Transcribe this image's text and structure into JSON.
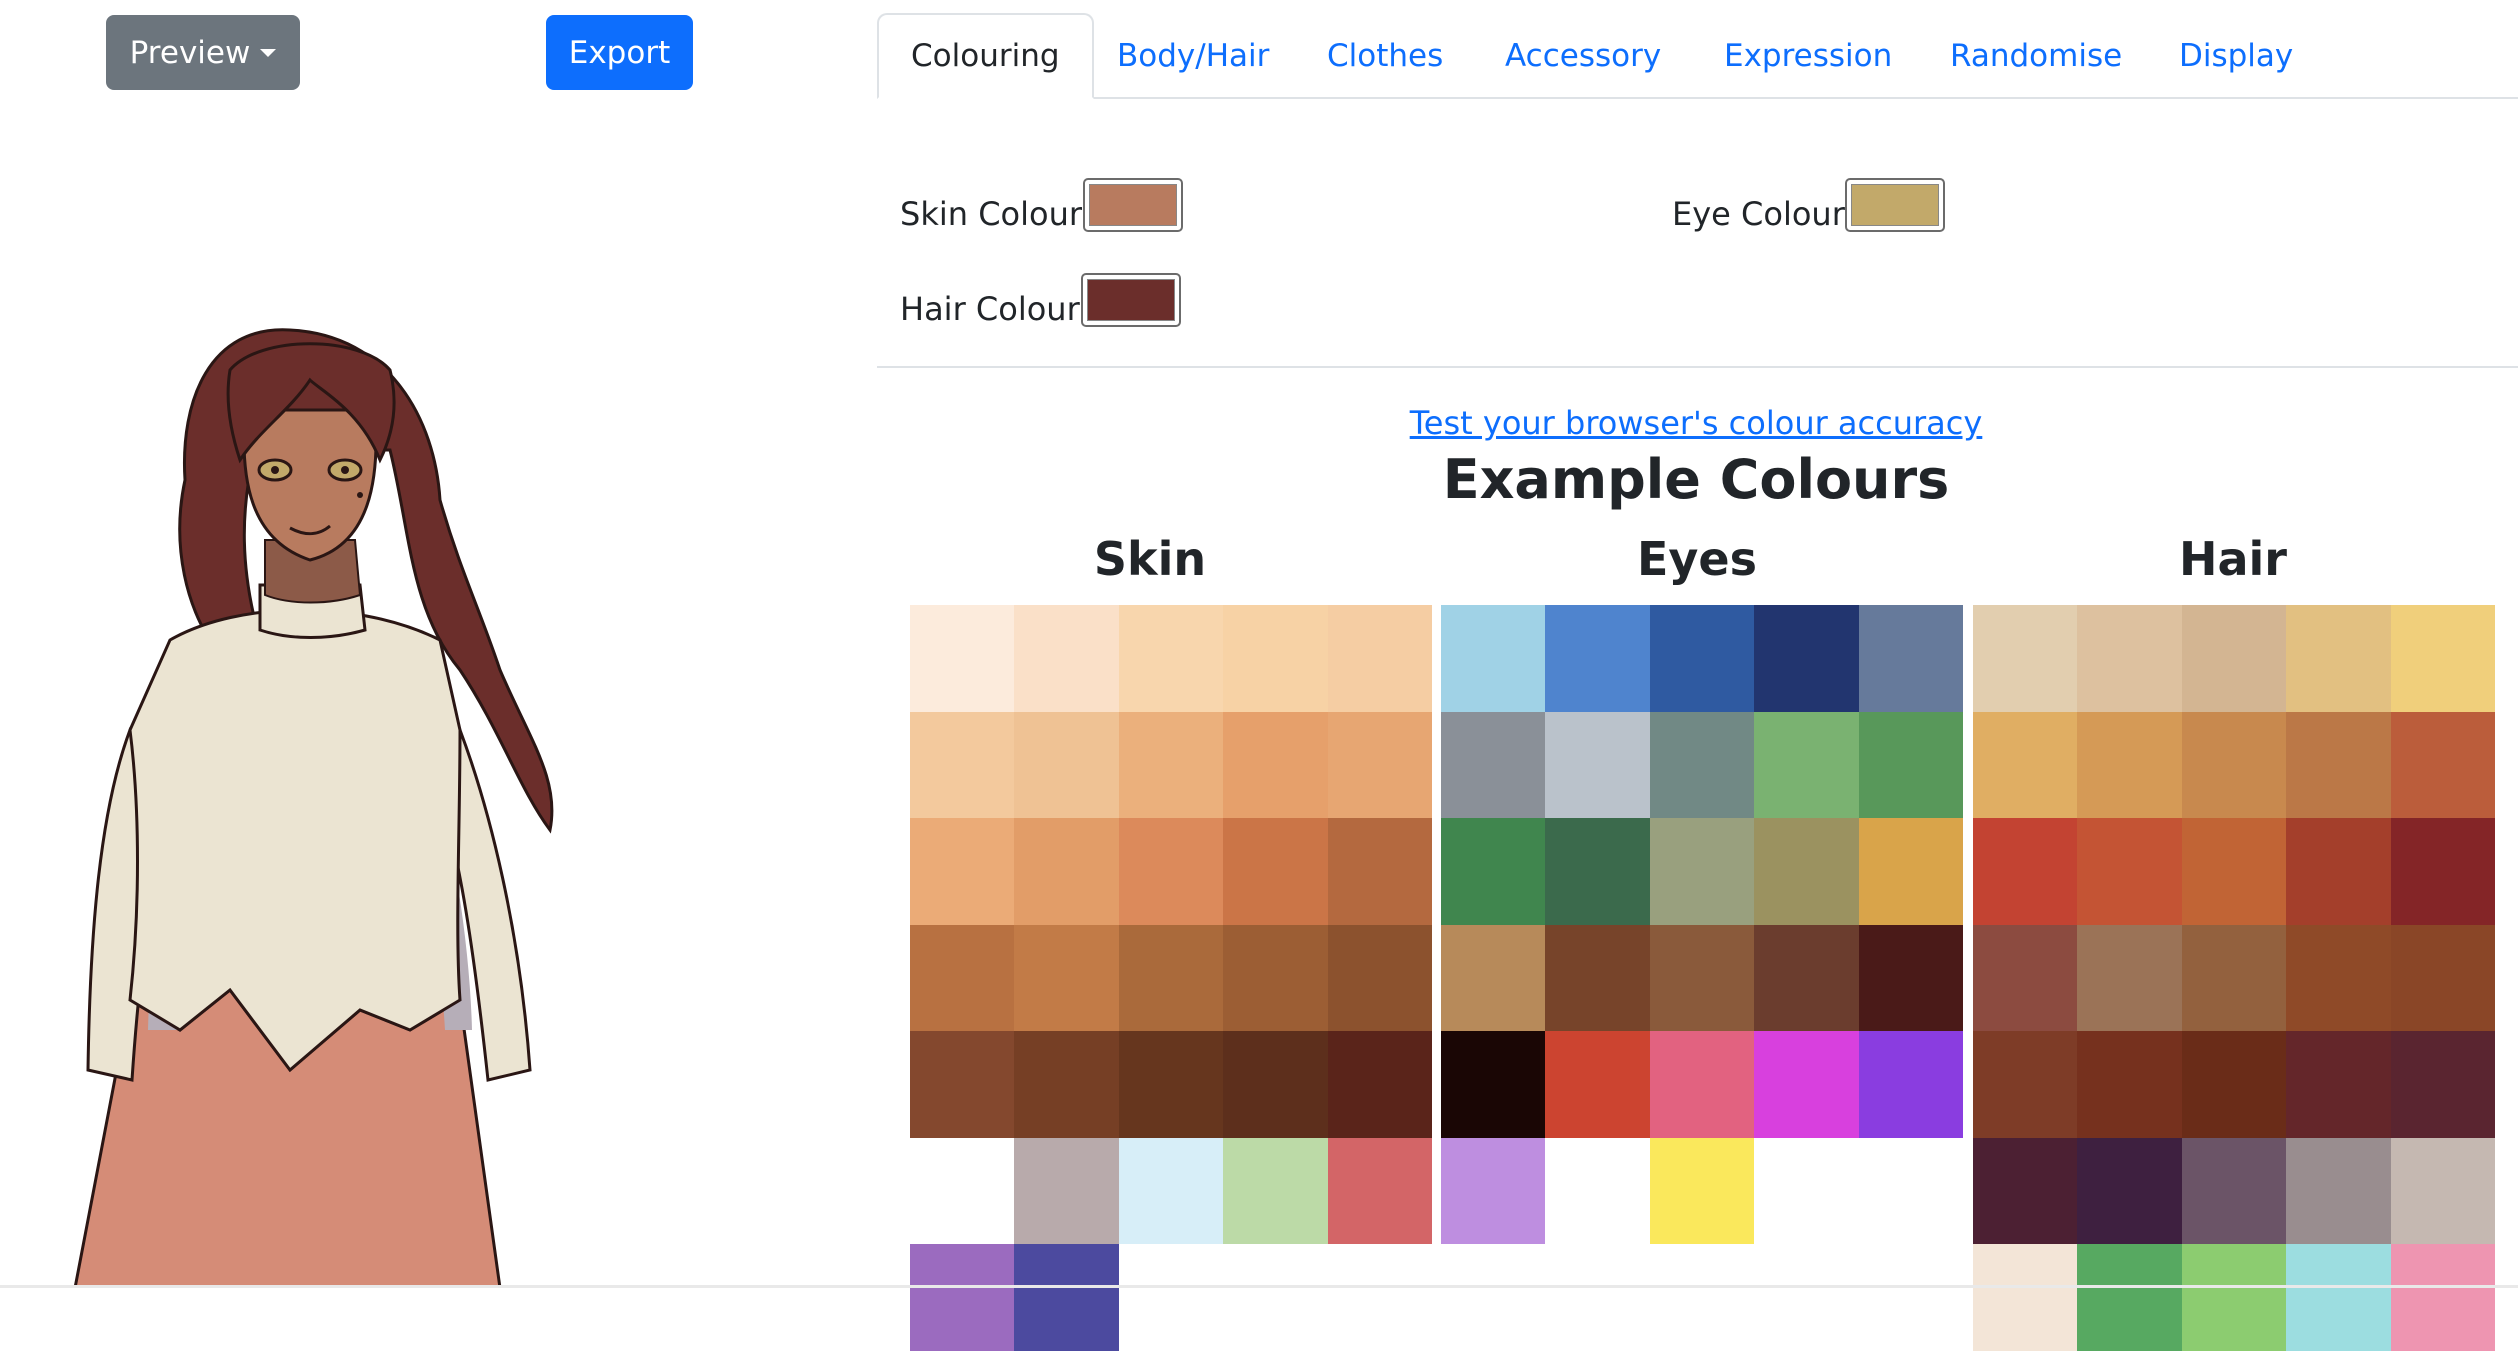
{
  "toolbar": {
    "preview_label": "Preview",
    "export_label": "Export"
  },
  "tabs": [
    {
      "label": "Colouring",
      "active": true
    },
    {
      "label": "Body/Hair"
    },
    {
      "label": "Clothes"
    },
    {
      "label": "Accessory"
    },
    {
      "label": "Expression"
    },
    {
      "label": "Randomise"
    },
    {
      "label": "Display"
    }
  ],
  "colouring": {
    "skin_label": "Skin Colour:",
    "skin_value": "#b87b5f",
    "eye_label": "Eye Colour:",
    "eye_value": "#c2a96a",
    "hair_label": "Hair Colour:",
    "hair_value": "#6b2e2b"
  },
  "accuracy_link": "Test your browser's colour accuracy",
  "examples": {
    "title": "Example Colours",
    "skin": {
      "title": "Skin",
      "rows": [
        [
          "#fcebdc",
          "#fae0c8",
          "#f8d6ad",
          "#f7d2a5",
          "#f5cda3"
        ],
        [
          "#f3c99d",
          "#efc294",
          "#ebb07c",
          "#e6a06b",
          "#e7a672"
        ],
        [
          "#ebab77",
          "#e29d68",
          "#dc8a5b",
          "#cb7547",
          "#b4693f"
        ],
        [
          "#b87141",
          "#c27b47",
          "#aa6a3b",
          "#9c5e34",
          "#8c522e"
        ],
        [
          "#84482e",
          "#763f25",
          "#66361e",
          "#5d2f1c",
          "#5a241a"
        ],
        [
          null,
          "#b8aaab",
          "#d7eef8",
          "#bcdaa7",
          "#d36567"
        ],
        [
          "#9b6bbf",
          "#4c4a9f",
          null,
          null,
          null
        ]
      ]
    },
    "eyes": {
      "title": "Eyes",
      "rows": [
        [
          "#a0d2e6",
          "#4f84ce",
          "#2f5aa1",
          "#22356f",
          "#667a9b"
        ],
        [
          "#8a9098",
          "#bac2cb",
          "#718985",
          "#7ab271",
          "#58985a"
        ],
        [
          "#40864e",
          "#3b6a4c",
          "#99a07e",
          "#9b9260",
          "#d9a44a"
        ],
        [
          "#b78a5a",
          "#77442a",
          "#8a5a3b",
          "#6b3d2e",
          "#4a1a18"
        ],
        [
          "#1a0605",
          "#cc4430",
          "#e26280",
          "#d840de",
          "#8a3de0"
        ],
        [
          "#be8ee0",
          null,
          "#fae85c",
          null,
          null
        ]
      ]
    },
    "hair": {
      "title": "Hair",
      "rows": [
        [
          "#e2ceaf",
          "#ddc19f",
          "#d3b592",
          "#e2c081",
          "#f0cf7b"
        ],
        [
          "#e0ae63",
          "#d59a56",
          "#c8894e",
          "#bb7847",
          "#bb5d3b"
        ],
        [
          "#c34332",
          "#c45434",
          "#c16435",
          "#a43f2b",
          "#842527"
        ],
        [
          "#8c4b40",
          "#9b7357",
          "#93613e",
          "#8f4a28",
          "#8a4627"
        ],
        [
          "#7e3c27",
          "#76311e",
          "#6a2c18",
          "#64262a",
          "#5a2530"
        ],
        [
          "#4c2033",
          "#3e2040",
          "#6b5467",
          "#998d8f",
          "#c5b8b1"
        ],
        [
          "#f3e5d7",
          "#57a961",
          "#8ccc70",
          "#9cdde0",
          "#ee95b1"
        ]
      ]
    }
  }
}
